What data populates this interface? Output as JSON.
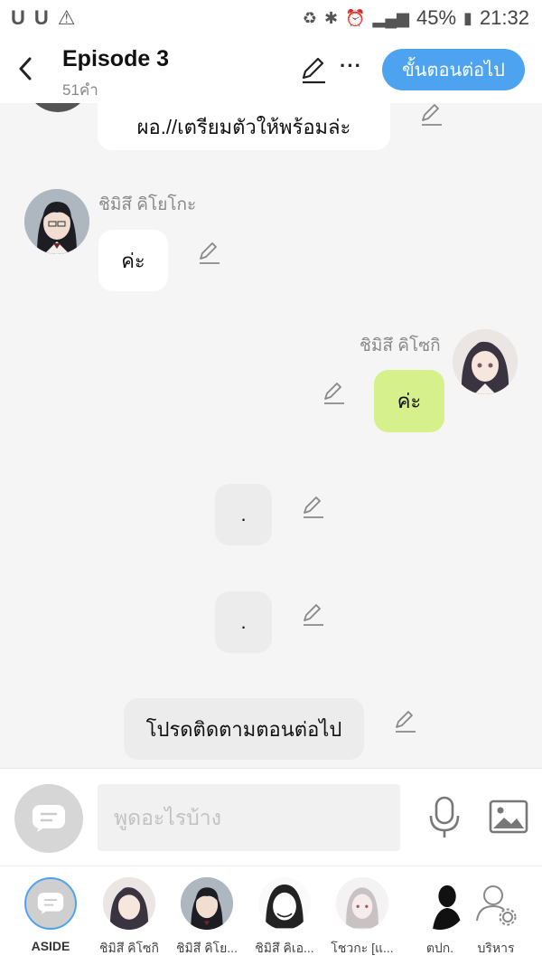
{
  "status_bar": {
    "battery": "45%",
    "time": "21:32",
    "left_icons": [
      "U",
      "U",
      "⚠"
    ]
  },
  "header": {
    "back_icon": "chevron-left-icon",
    "title": "Episode 3",
    "word_count": "51คำ",
    "next_button": "ขั้นตอนต่อไป"
  },
  "messages": [
    {
      "type": "left",
      "text": "ผอ.//เตรียมตัวให้พร้อมล่ะ"
    },
    {
      "type": "left",
      "name": "ชิมิสึ คิโยโกะ",
      "text": "ค่ะ"
    },
    {
      "type": "right",
      "name": "ชิมิสึ คิโซกิ",
      "text": "ค่ะ"
    },
    {
      "type": "center",
      "text": "."
    },
    {
      "type": "center",
      "text": "."
    },
    {
      "type": "center",
      "text": "โปรดติดตามตอนต่อไป"
    }
  ],
  "input": {
    "placeholder": "พูดอะไรบ้าง"
  },
  "characters": [
    {
      "label": "ASIDE"
    },
    {
      "label": "ชิมิสึ คิโซกิ"
    },
    {
      "label": "ชิมิสึ คิโย..."
    },
    {
      "label": "ชิมิสึ คิเอ..."
    },
    {
      "label": "โชวกะ [แ..."
    },
    {
      "label": "ตปก."
    },
    {
      "label": "บริหาร"
    }
  ],
  "colors": {
    "accent": "#4da3ef",
    "green_bubble": "#d6f08b",
    "background": "#f5f5f5"
  }
}
